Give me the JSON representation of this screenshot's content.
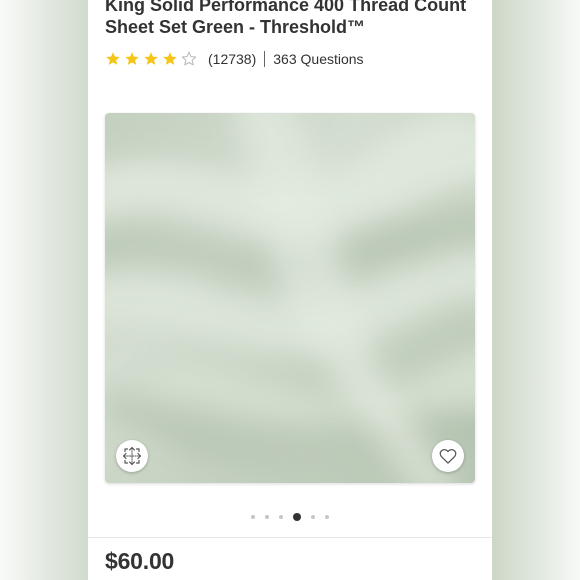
{
  "product": {
    "title_line1": "King Solid Performance 400 Thread Count",
    "title_line2": "Sheet Set Green - Threshold™",
    "rating": 4,
    "rating_max": 5,
    "review_count": "(12738)",
    "questions": "363 Questions",
    "price": "$60.00"
  },
  "gallery": {
    "total_images": 6,
    "active_index": 3,
    "expand_icon": "expand-arrows-icon",
    "favorite_icon": "heart-outline-icon"
  },
  "colors": {
    "star_fill": "#f5c518",
    "star_empty": "#b7b7b7",
    "fabric": "#c9d5c6",
    "text": "#333333"
  }
}
